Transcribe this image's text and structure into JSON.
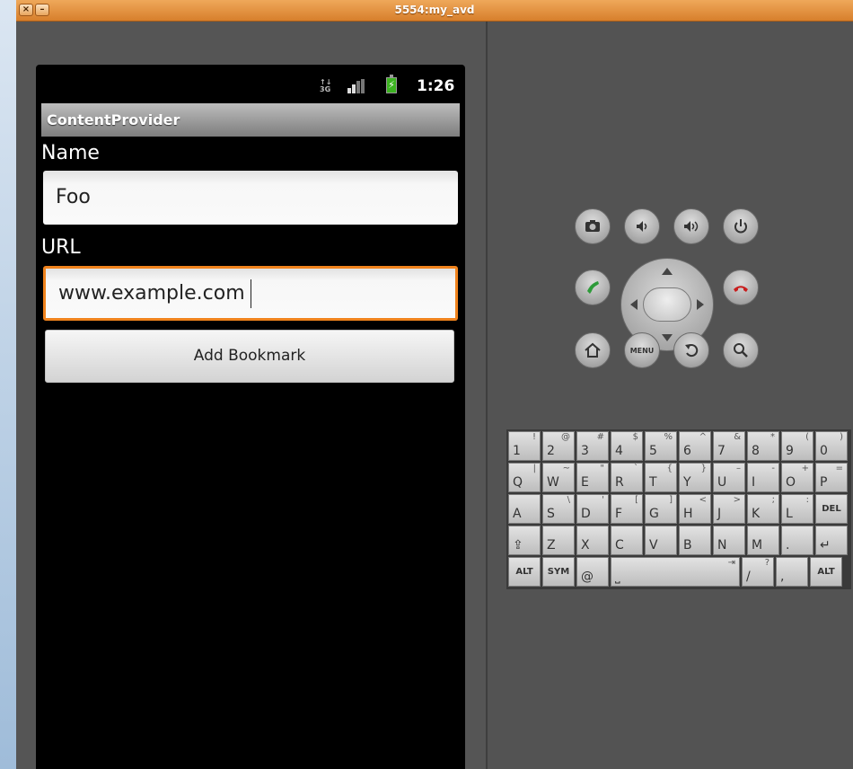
{
  "window": {
    "title": "5554:my_avd",
    "close_glyph": "×",
    "minimize_glyph": "–"
  },
  "statusbar": {
    "network": "3G",
    "network_top": "↑↓",
    "time": "1:26",
    "battery_glyph": "⚡"
  },
  "app": {
    "title": "ContentProvider",
    "name_label": "Name",
    "name_value": "Foo",
    "url_label": "URL",
    "url_value": "www.example.com",
    "button_label": "Add Bookmark"
  },
  "hardware": {
    "menu_label": "MENU",
    "icons": [
      "camera-icon",
      "volume-down-icon",
      "volume-up-icon",
      "power-icon",
      "call-icon",
      "dpad",
      "end-call-icon",
      "home-icon",
      "menu-icon",
      "back-icon",
      "search-icon"
    ]
  },
  "keyboard": {
    "row1": [
      {
        "main": "1",
        "sub": "!"
      },
      {
        "main": "2",
        "sub": "@"
      },
      {
        "main": "3",
        "sub": "#"
      },
      {
        "main": "4",
        "sub": "$"
      },
      {
        "main": "5",
        "sub": "%"
      },
      {
        "main": "6",
        "sub": "^"
      },
      {
        "main": "7",
        "sub": "&"
      },
      {
        "main": "8",
        "sub": "*"
      },
      {
        "main": "9",
        "sub": "("
      },
      {
        "main": "0",
        "sub": ")"
      }
    ],
    "row2": [
      {
        "main": "Q",
        "sub": "|"
      },
      {
        "main": "W",
        "sub": "~"
      },
      {
        "main": "E",
        "sub": "\""
      },
      {
        "main": "R",
        "sub": "`"
      },
      {
        "main": "T",
        "sub": "{"
      },
      {
        "main": "Y",
        "sub": "}"
      },
      {
        "main": "U",
        "sub": "–"
      },
      {
        "main": "I",
        "sub": "-"
      },
      {
        "main": "O",
        "sub": "+"
      },
      {
        "main": "P",
        "sub": "="
      }
    ],
    "row3": [
      {
        "main": "A",
        "sub": ""
      },
      {
        "main": "S",
        "sub": "\\"
      },
      {
        "main": "D",
        "sub": "'"
      },
      {
        "main": "F",
        "sub": "["
      },
      {
        "main": "G",
        "sub": "]"
      },
      {
        "main": "H",
        "sub": "<"
      },
      {
        "main": "J",
        "sub": ">"
      },
      {
        "main": "K",
        "sub": ";"
      },
      {
        "main": "L",
        "sub": ":"
      },
      {
        "main": "DEL",
        "sub": ""
      }
    ],
    "row4": [
      {
        "main": "⇪",
        "sub": ""
      },
      {
        "main": "Z",
        "sub": ""
      },
      {
        "main": "X",
        "sub": ""
      },
      {
        "main": "C",
        "sub": ""
      },
      {
        "main": "V",
        "sub": ""
      },
      {
        "main": "B",
        "sub": ""
      },
      {
        "main": "N",
        "sub": ""
      },
      {
        "main": "M",
        "sub": ""
      },
      {
        "main": ".",
        "sub": ""
      },
      {
        "main": "↵",
        "sub": ""
      }
    ],
    "row5": [
      {
        "main": "ALT",
        "sub": ""
      },
      {
        "main": "SYM",
        "sub": ""
      },
      {
        "main": "@",
        "sub": ""
      },
      {
        "main": "⎵",
        "sub": "⇥"
      },
      {
        "main": "/",
        "sub": "?"
      },
      {
        "main": ",",
        "sub": ""
      },
      {
        "main": "ALT",
        "sub": ""
      }
    ]
  }
}
